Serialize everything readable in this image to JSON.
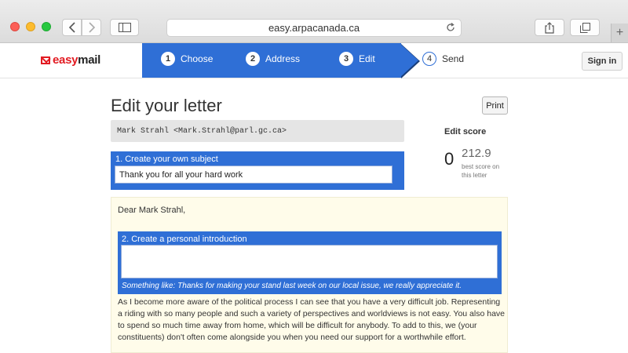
{
  "browser": {
    "url": "easy.arpacanada.ca"
  },
  "site": {
    "logo_easy": "easy",
    "logo_mail": "mail",
    "steps": [
      {
        "num": "1",
        "label": "Choose"
      },
      {
        "num": "2",
        "label": "Address"
      },
      {
        "num": "3",
        "label": "Edit"
      },
      {
        "num": "4",
        "label": "Send"
      }
    ],
    "signin_label": "Sign in"
  },
  "page": {
    "title": "Edit your letter",
    "print_label": "Print",
    "recipient": "Mark Strahl <Mark.Strahl@parl.gc.ca>",
    "subject_label": "1. Create your own subject",
    "subject_value": "Thank you for all your hard work",
    "score_title": "Edit score",
    "score_value": "0",
    "best_score": "212.9",
    "best_score_label": "best score on this letter",
    "greeting": "Dear Mark Strahl,",
    "intro_label": "2. Create a personal introduction",
    "intro_hint": "Something like: Thanks for making your stand last week on our local issue, we really appreciate it.",
    "body": "As I become more aware of the political process I can see that you have a very difficult job. Representing a riding with so many people and such a variety of perspectives and worldviews is not easy. You also have to spend so much time away from home, which will be difficult for anybody. To add to this, we (your constituents) don't often come alongside you when you need our support for a worthwhile effort."
  },
  "colors": {
    "accent": "#2f6fd6",
    "brand_red": "#e21b22",
    "letter_bg": "#fffcea"
  }
}
